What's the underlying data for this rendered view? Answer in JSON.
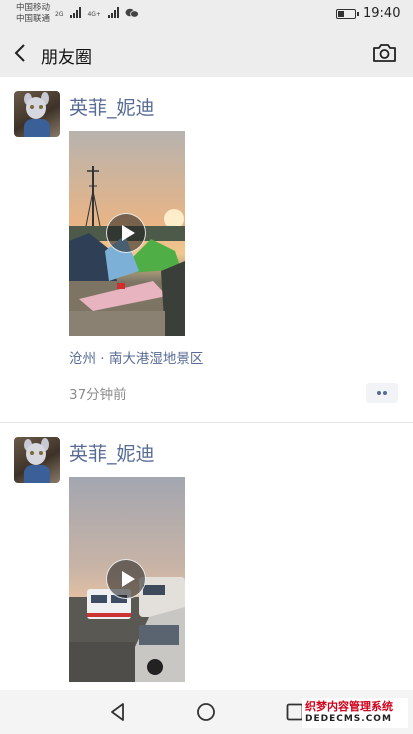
{
  "status_bar": {
    "carrier_1": "中国移动",
    "carrier_2": "中国联通",
    "net_1": "2G",
    "net_2": "4G+",
    "time": "19:40",
    "icons": [
      "signal-icon",
      "wechat-notification-icon",
      "battery-icon"
    ]
  },
  "nav": {
    "title": "朋友圈",
    "back_icon": "chevron-left-icon",
    "camera_icon": "camera-icon"
  },
  "posts": [
    {
      "username": "英菲_妮迪",
      "media": "video",
      "location": "沧州 · 南大港湿地景区",
      "time_ago": "37分钟前",
      "more_icon": "more-dots-icon"
    },
    {
      "username": "英菲_妮迪",
      "media": "video"
    }
  ],
  "system_nav": {
    "icons": [
      "back-triangle-icon",
      "home-circle-icon",
      "recent-square-icon"
    ]
  },
  "watermark": {
    "line1": "织梦内容管理系统",
    "line2": "DEDECMS.COM"
  },
  "colors": {
    "link_blue": "#576b95",
    "header_bg": "#ededed",
    "muted_text": "#8c8c8c"
  }
}
